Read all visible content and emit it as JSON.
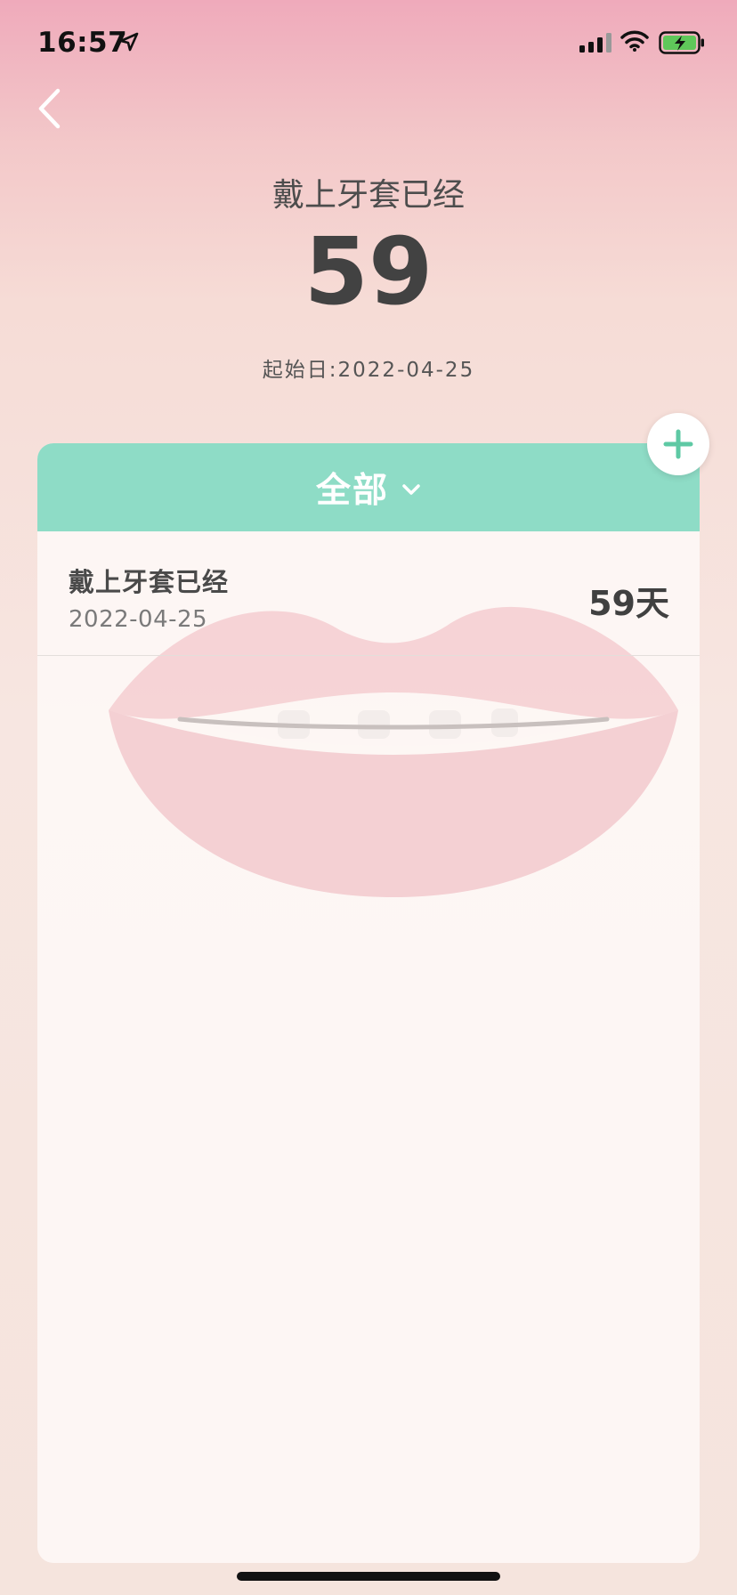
{
  "status_bar": {
    "time": "16:57"
  },
  "header": {
    "title": "戴上牙套已经",
    "count": "59",
    "start_label": "起始日:",
    "start_date": "2022-04-25"
  },
  "filter": {
    "label": "全部"
  },
  "records": [
    {
      "title": "戴上牙套已经",
      "date": "2022-04-25",
      "days": "59天"
    }
  ],
  "colors": {
    "accent": "#8edcc6",
    "add_icon": "#5ec9a4"
  },
  "icons": {
    "back": "chevron-left-icon",
    "location": "location-arrow-icon",
    "signal": "cellular-signal-icon",
    "wifi": "wifi-icon",
    "battery": "battery-charging-icon",
    "filter": "chevron-down-icon",
    "add": "plus-icon"
  }
}
